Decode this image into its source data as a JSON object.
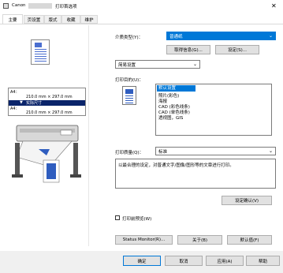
{
  "window": {
    "brand": "Canon",
    "title": "打印首选项",
    "close_glyph": "✕"
  },
  "tabs": [
    {
      "label": "主要"
    },
    {
      "label": "页设置"
    },
    {
      "label": "版式"
    },
    {
      "label": "收藏"
    },
    {
      "label": "维护"
    }
  ],
  "preview": {
    "info_line1": "A4：",
    "info_line2": "210.0 mm × 297.0 mm",
    "actual_size": "实际尺寸",
    "info_line3": "A4：",
    "info_line4": "210.0 mm × 297.0 mm"
  },
  "media": {
    "label": "介质类型(Y)：",
    "value": "普通纸",
    "get_info_button": "取得信息(G)...",
    "settings_button": "设定(S)..."
  },
  "mode_select": {
    "value": "简易设置"
  },
  "purpose": {
    "label": "打印目的(U)：",
    "items": [
      {
        "label": "默认设置",
        "selected": true
      },
      {
        "label": "照片(彩色)",
        "selected": false
      },
      {
        "label": "海报",
        "selected": false
      },
      {
        "label": "CAD (彩色线条)",
        "selected": false
      },
      {
        "label": "CAD (单色线条)",
        "selected": false
      },
      {
        "label": "透视图，GIS",
        "selected": false
      }
    ]
  },
  "quality": {
    "label": "打印质量(Q)：",
    "value": "标准",
    "description": "以最合理的设定，对普通文字/图像/图形等的文章进行打印。",
    "confirm_button": "设定确认(V)"
  },
  "preview_checkbox": {
    "label": "打印前预览(W)",
    "checked": false
  },
  "bottom_buttons": {
    "status_monitor": "Status Monitor(R)...",
    "about": "关于(B)",
    "defaults": "默认值(F)"
  },
  "dialog_buttons": {
    "ok": "确定",
    "cancel": "取消",
    "apply": "应用(A)",
    "help": "帮助"
  },
  "colors": {
    "selection": "#0078d7",
    "blue_bar": "#0a246a",
    "accent_blue": "#2f5dbf"
  }
}
